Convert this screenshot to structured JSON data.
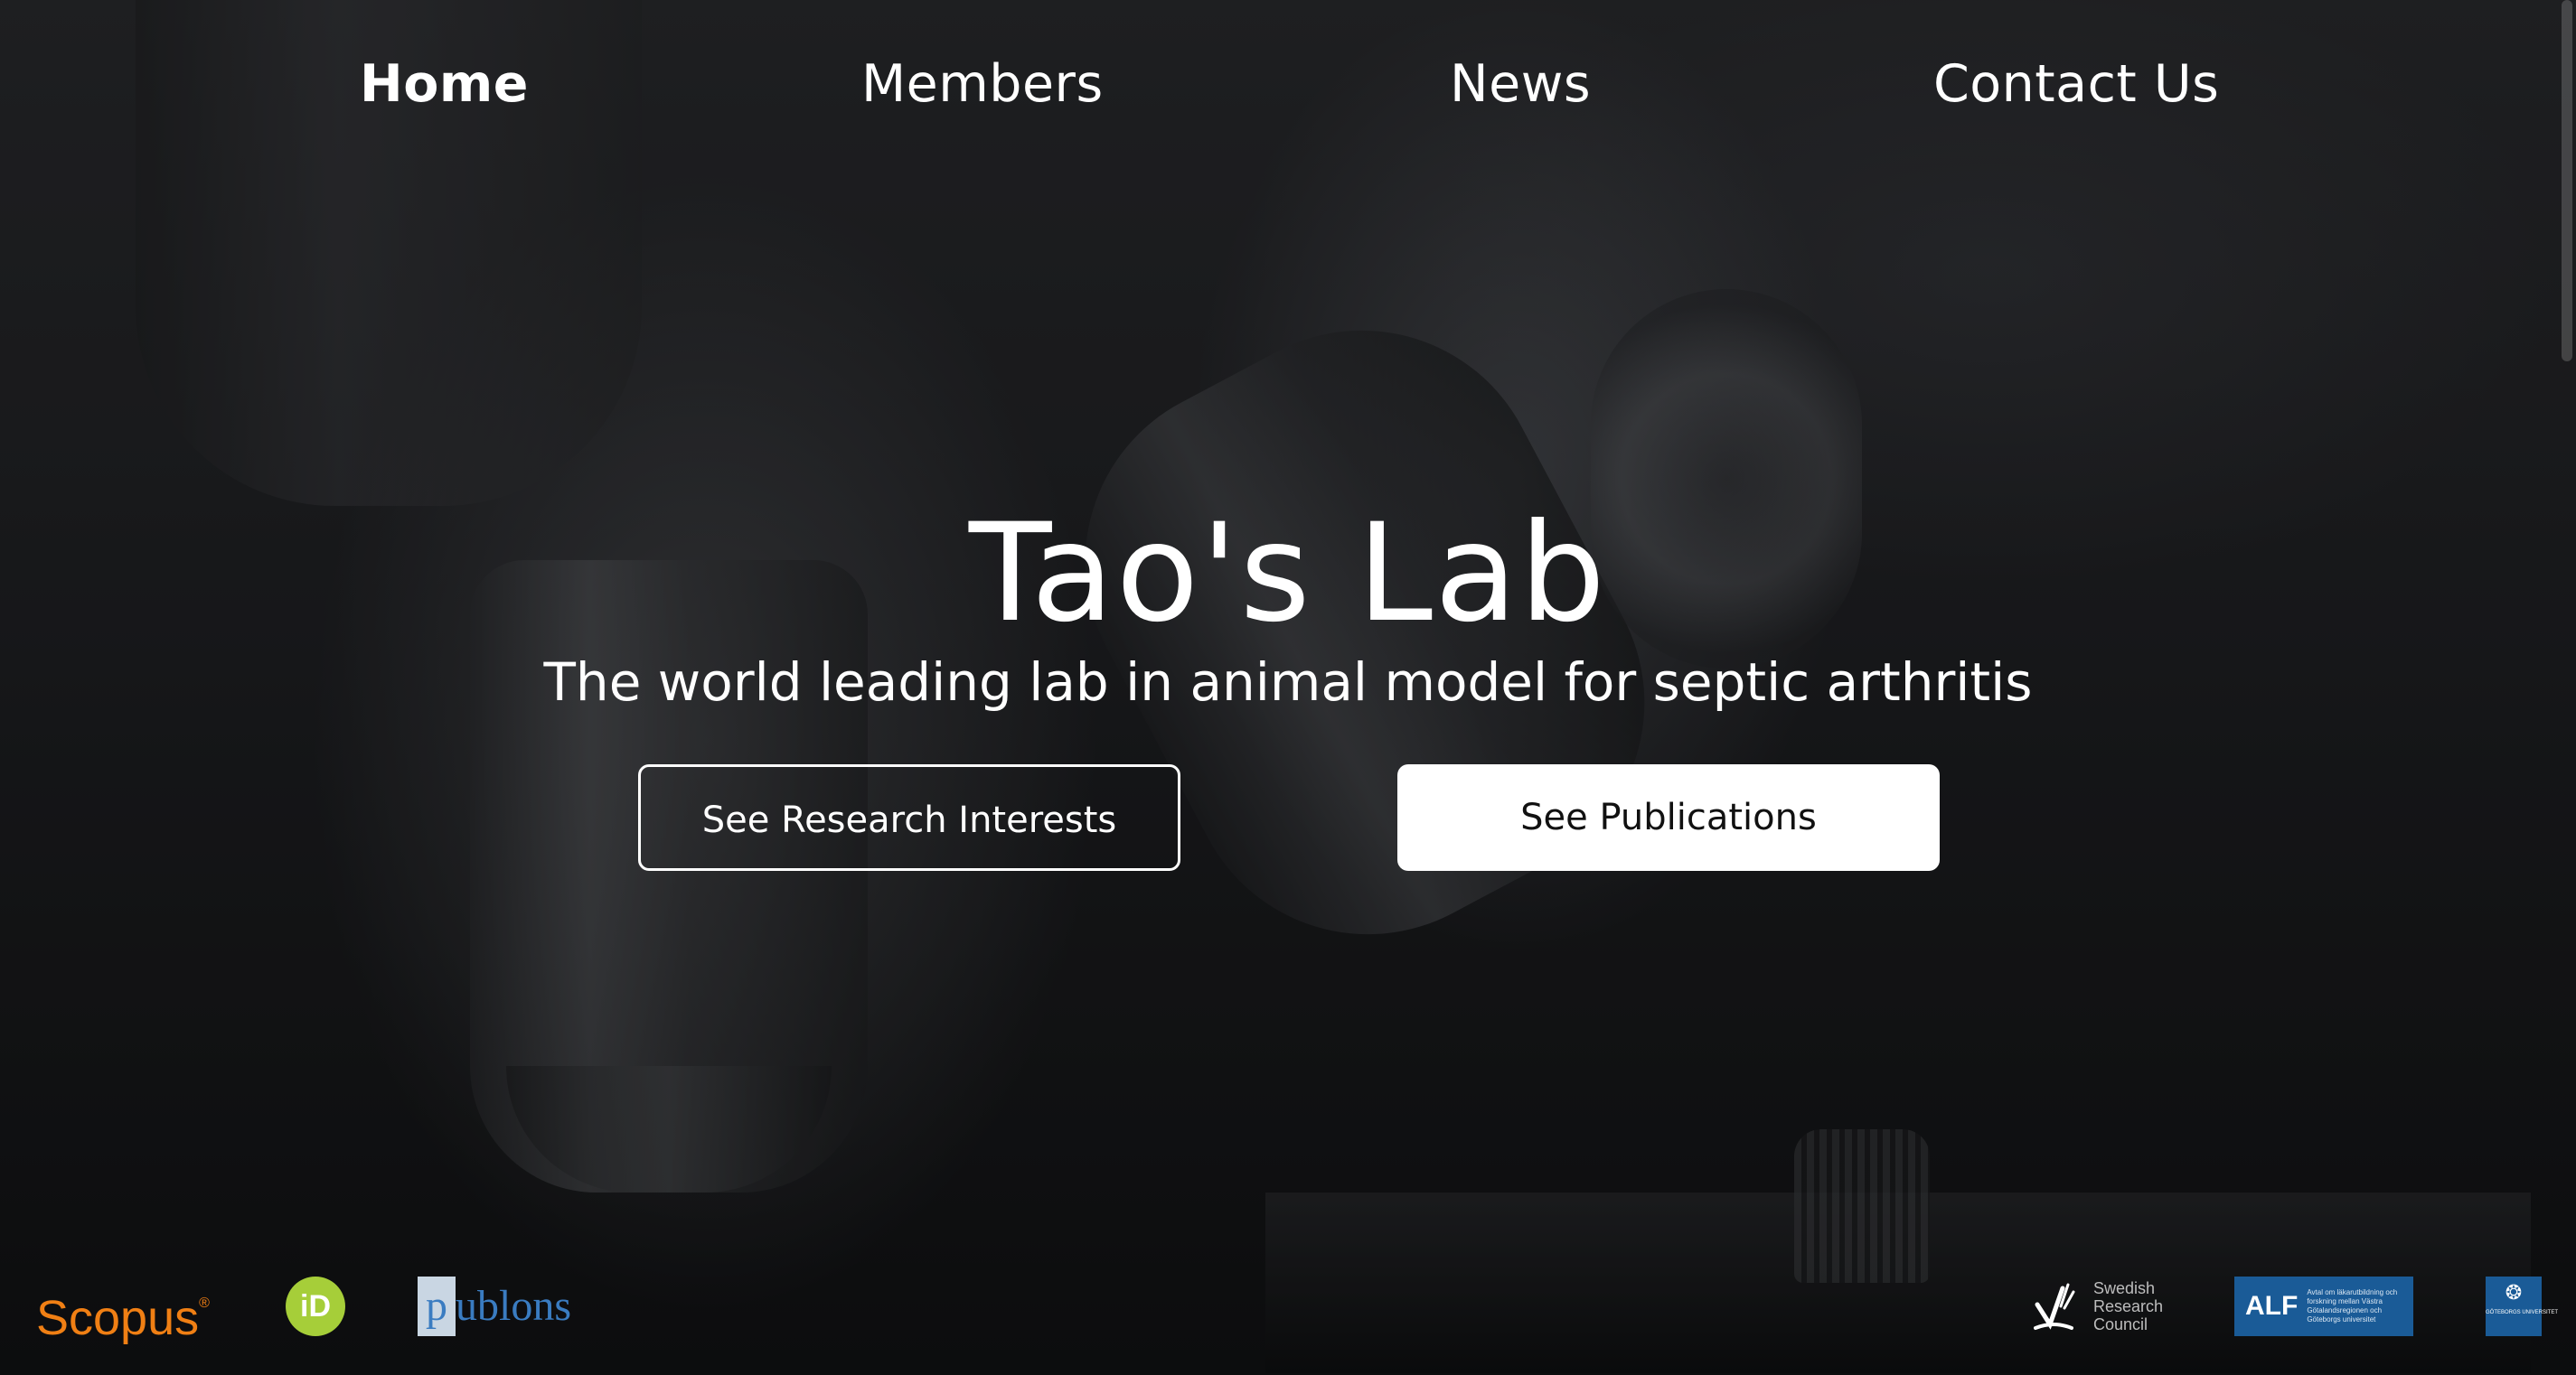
{
  "nav": {
    "items": [
      {
        "label": "Home",
        "active": true
      },
      {
        "label": "Members",
        "active": false
      },
      {
        "label": "News",
        "active": false
      },
      {
        "label": "Contact Us",
        "active": false
      }
    ]
  },
  "hero": {
    "title": "Tao's Lab",
    "subtitle": "The world leading lab in animal model for septic arthritis",
    "buttons": {
      "research": "See Research Interests",
      "publications": "See Publications"
    }
  },
  "footer": {
    "logos": {
      "scopus": "Scopus",
      "orcid": "iD",
      "publons_initial": "p",
      "publons_rest": "ublons",
      "vr": [
        "Swedish",
        "Research",
        "Council"
      ],
      "alf_big": "ALF",
      "alf_small": "Avtal om läkarutbildning och forskning mellan Västra Götalandsregionen och Göteborgs universitet",
      "gu": "GÖTEBORGS UNIVERSITET"
    }
  },
  "colors": {
    "scopus_orange": "#f07f14",
    "orcid_green": "#a6ce39",
    "publons_blue": "#3a7cc1",
    "alf_blue": "#1a5b97"
  }
}
